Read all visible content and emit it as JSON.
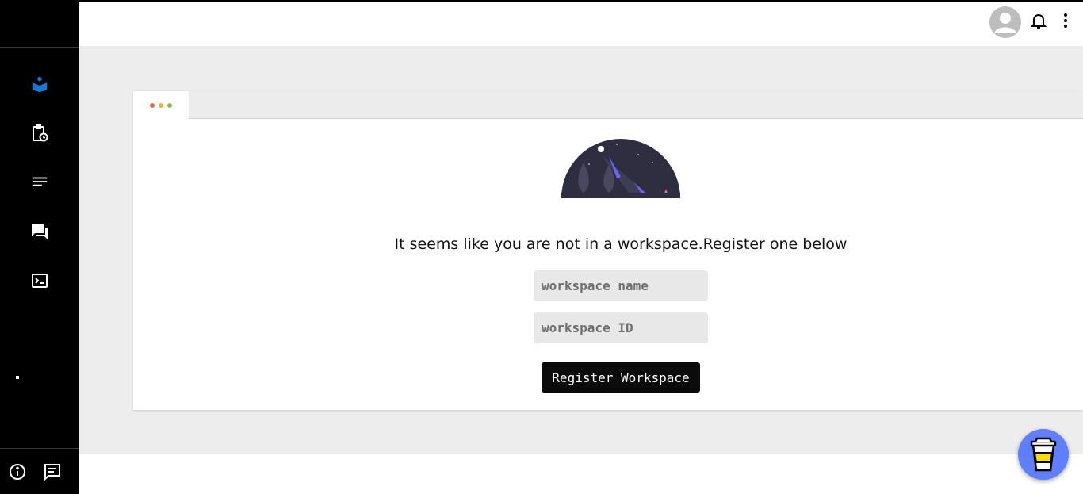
{
  "main": {
    "message": "It seems like you are not in a workspace.Register one below",
    "workspace_name_placeholder": "workspace name",
    "workspace_id_placeholder": "workspace ID",
    "register_label": "Register Workspace"
  },
  "sidebar": {
    "items": [
      {
        "icon": "book-reader-icon",
        "active": true
      },
      {
        "icon": "clipboard-clock-icon"
      },
      {
        "icon": "notes-icon"
      },
      {
        "icon": "forum-icon"
      },
      {
        "icon": "terminal-icon"
      }
    ],
    "bottom": [
      {
        "icon": "info-icon"
      },
      {
        "icon": "feedback-icon"
      }
    ]
  },
  "header": {
    "icons": [
      "account-avatar-icon",
      "bell-icon",
      "more-vert-icon"
    ]
  },
  "colors": {
    "accent": "#1976d2",
    "sidebar_bg": "#000000",
    "main_bg": "#ededed",
    "button_bg": "#0b0b0b",
    "fab_bg": "#5f7fff",
    "dot_red": "#f06a4a",
    "dot_yellow": "#f0b040",
    "dot_green": "#8cb860"
  },
  "fab": {
    "icon": "coffee-cup-icon"
  }
}
